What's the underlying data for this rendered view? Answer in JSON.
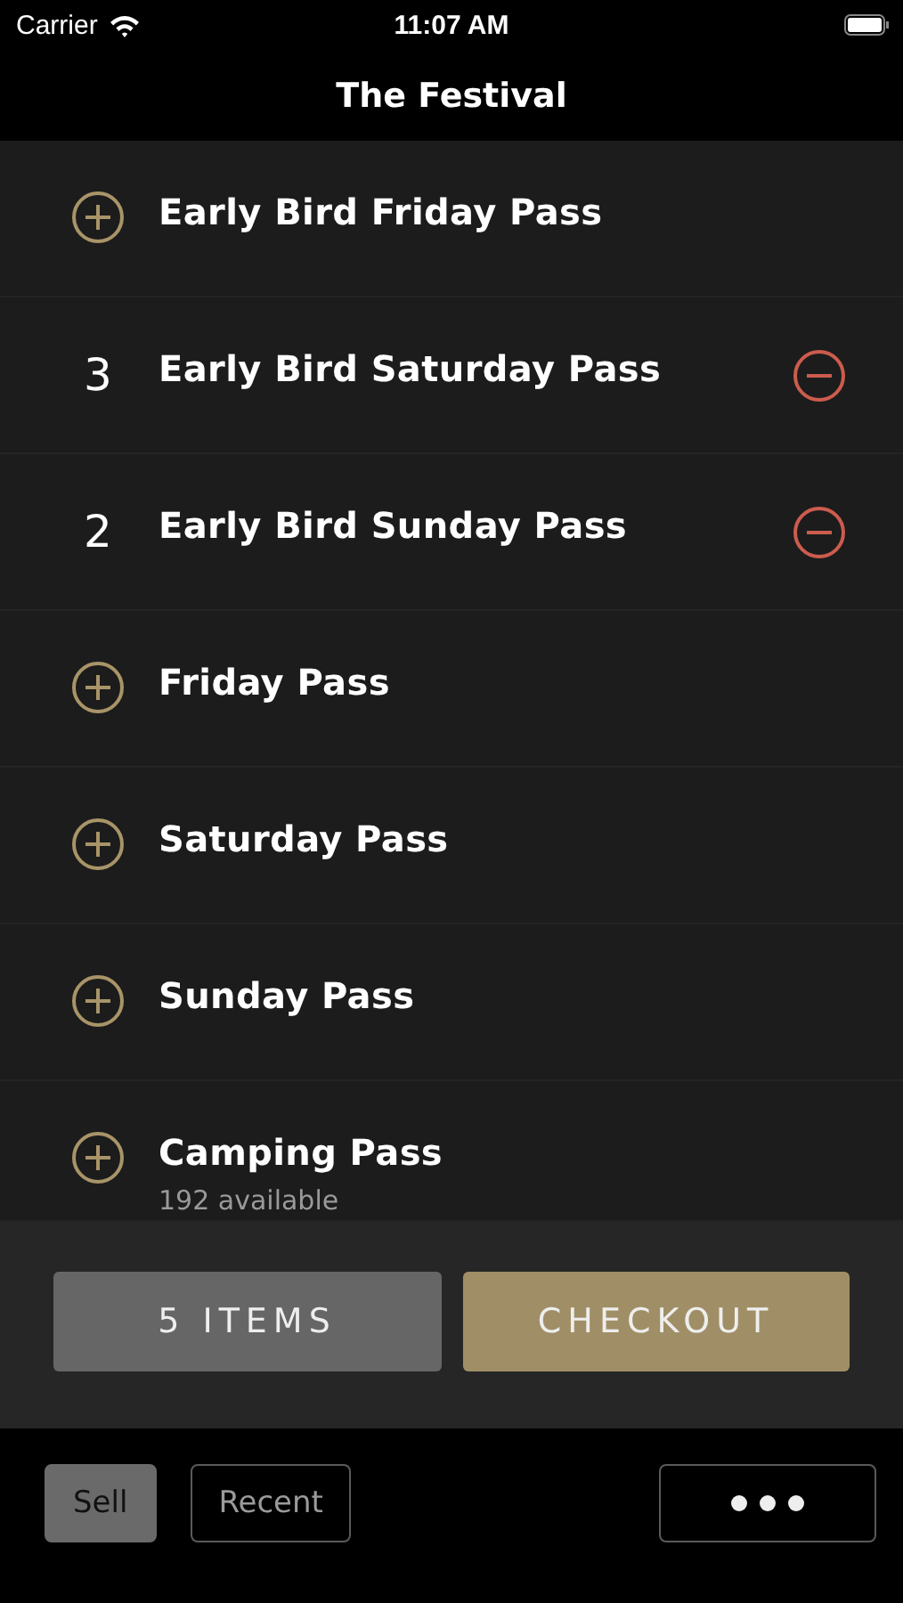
{
  "status_bar": {
    "carrier": "Carrier",
    "time": "11:07 AM"
  },
  "nav": {
    "title": "The Festival"
  },
  "passes": [
    {
      "kind": "add",
      "name": "Early Bird Friday Pass"
    },
    {
      "kind": "quantity",
      "quantity": "3",
      "name": "Early Bird Saturday Pass"
    },
    {
      "kind": "quantity",
      "quantity": "2",
      "name": "Early Bird Sunday Pass"
    },
    {
      "kind": "add",
      "name": "Friday Pass"
    },
    {
      "kind": "add",
      "name": "Saturday Pass"
    },
    {
      "kind": "add",
      "name": "Sunday Pass"
    },
    {
      "kind": "add",
      "name": "Camping Pass",
      "availability": "192 available"
    }
  ],
  "cart": {
    "items": "5 ITEMS",
    "checkout": "CHECKOUT"
  },
  "tabs": [
    {
      "label": "Sell",
      "selected": true
    },
    {
      "label": "Recent",
      "selected": false
    }
  ]
}
